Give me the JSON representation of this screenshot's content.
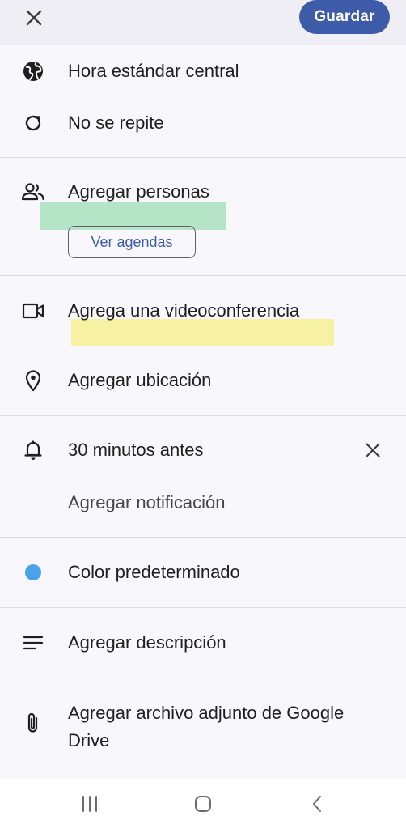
{
  "header": {
    "close_icon": "close-icon",
    "save_label": "Guardar"
  },
  "timezone": {
    "icon": "globe-icon",
    "label": "Hora estándar central"
  },
  "repeat": {
    "icon": "repeat-icon",
    "label": "No se repite"
  },
  "people": {
    "icon": "people-icon",
    "label": "Agregar personas",
    "agendas_button": "Ver agendas",
    "highlight_color": "#7fd59a"
  },
  "video": {
    "icon": "videocam-icon",
    "label": "Agrega una videoconferencia",
    "highlight_color": "#f5ee5a"
  },
  "location": {
    "icon": "location-pin-icon",
    "label": "Agregar ubicación"
  },
  "notifications": {
    "icon": "bell-icon",
    "current": "30 minutos antes",
    "remove_icon": "close-icon",
    "add_label": "Agregar notificación"
  },
  "color": {
    "label": "Color predeterminado",
    "swatch": "#4aa3e8"
  },
  "description": {
    "icon": "notes-icon",
    "label": "Agregar descripción"
  },
  "attachment": {
    "icon": "paperclip-icon",
    "line1": "Agregar archivo adjunto de Google",
    "line2": "Drive"
  },
  "navbar": {
    "recents_icon": "recents-icon",
    "home_icon": "home-icon",
    "back_icon": "back-icon"
  },
  "colors": {
    "accent": "#3d5ba8",
    "background": "#f8f7fc",
    "topbar": "#eeeef4"
  }
}
